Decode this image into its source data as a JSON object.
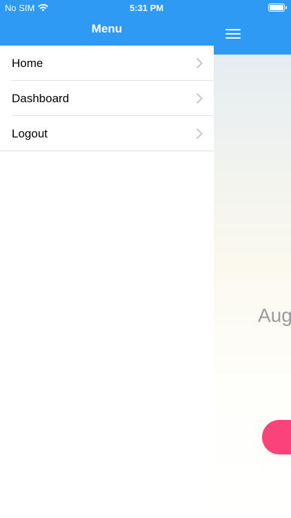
{
  "status_bar": {
    "carrier": "No SIM",
    "time": "5:31 PM",
    "battery_level": 1.0
  },
  "drawer": {
    "title": "Menu",
    "items": [
      {
        "label": "Home",
        "icon": "chevron-right-icon"
      },
      {
        "label": "Dashboard",
        "icon": "chevron-right-icon"
      },
      {
        "label": "Logout",
        "icon": "chevron-right-icon"
      }
    ]
  },
  "main": {
    "menu_icon": "hamburger-icon",
    "date_text": "Aug"
  },
  "colors": {
    "accent": "#2e9af3",
    "button": "#f9437a",
    "date_text": "#9a9a9a"
  }
}
